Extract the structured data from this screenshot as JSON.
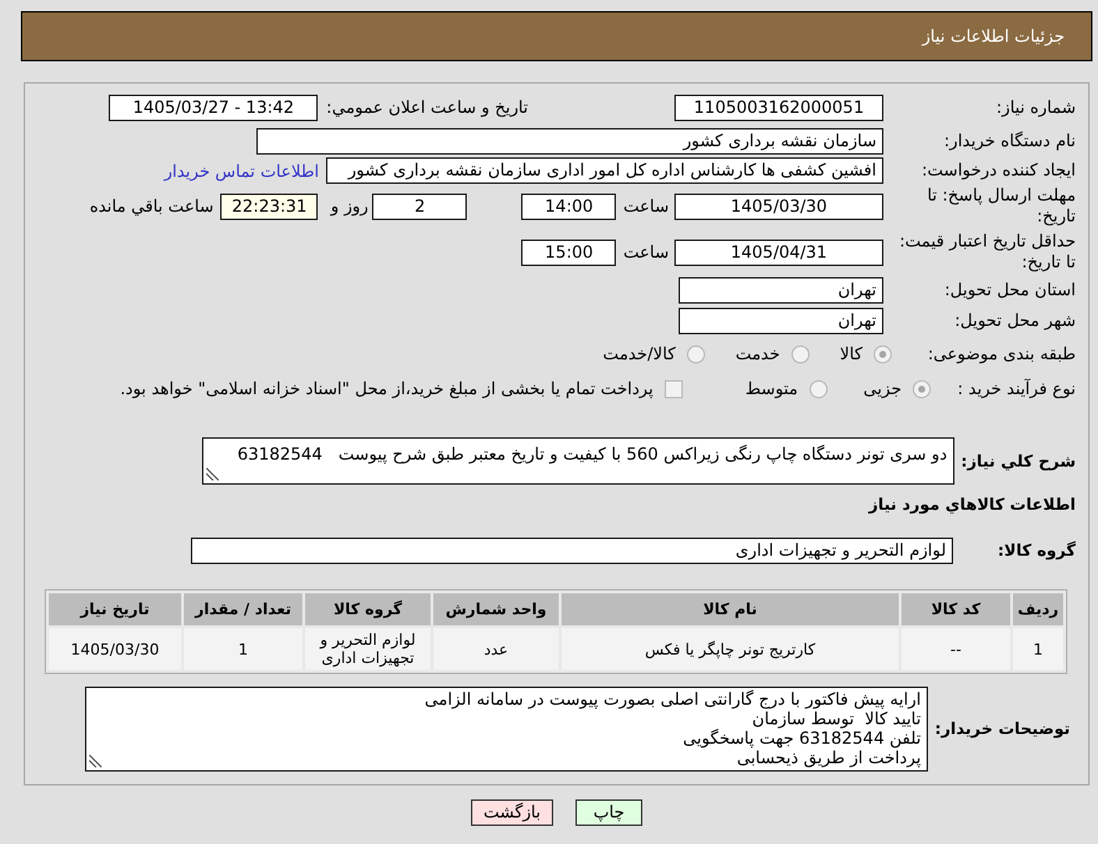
{
  "header": {
    "title": "جزئیات اطلاعات نیاز"
  },
  "need_number": {
    "label": "شماره نیاز:",
    "value": "1105003162000051"
  },
  "announce_datetime": {
    "label": "تاریخ و ساعت اعلان عمومي:",
    "value": "1405/03/27 - 13:42"
  },
  "buyer_org": {
    "label": "نام دستگاه خریدار:",
    "value": "سازمان نقشه برداری کشور"
  },
  "requester": {
    "label": "ایجاد کننده درخواست:",
    "value": "افشین کشفی ها کارشناس اداره کل امور اداری سازمان نقشه برداری کشور",
    "link": "اطلاعات تماس خریدار"
  },
  "response_deadline": {
    "label": "مهلت ارسال پاسخ: تا تاریخ:",
    "date": "1405/03/30",
    "time_label": "ساعت",
    "time": "14:00",
    "days": "2",
    "days_label": "روز و",
    "remaining": "22:23:31",
    "remaining_label": "ساعت باقي مانده"
  },
  "price_validity": {
    "label": "حداقل تاریخ اعتبار قیمت: تا تاریخ:",
    "date": "1405/04/31",
    "time_label": "ساعت",
    "time": "15:00"
  },
  "delivery_province": {
    "label": "استان محل تحویل:",
    "value": "تهران"
  },
  "delivery_city": {
    "label": "شهر محل تحویل:",
    "value": "تهران"
  },
  "subject_category": {
    "label": "طبقه بندی موضوعی:",
    "options": [
      {
        "label": "کالا",
        "selected": true,
        "disabled": true
      },
      {
        "label": "خدمت",
        "selected": false,
        "disabled": true
      },
      {
        "label": "کالا/خدمت",
        "selected": false,
        "disabled": true
      }
    ]
  },
  "purchase_process": {
    "label": "نوع فرآیند خرید :",
    "options": [
      {
        "label": "جزیی",
        "selected": true,
        "disabled": true
      },
      {
        "label": "متوسط",
        "selected": false,
        "disabled": true
      }
    ],
    "treasury_option": {
      "label": "پرداخت تمام یا بخشی از مبلغ خرید،از محل \"اسناد خزانه اسلامی\" خواهد بود.",
      "checked": false,
      "disabled": true
    }
  },
  "general_description": {
    "label": "شرح کلي نیاز:",
    "value": "دو سری تونر دستگاه چاپ رنگی زیراکس 560 با کیفیت و تاریخ معتبر طبق شرح پیوست   63182544"
  },
  "goods_heading": "اطلاعات کالاهاي مورد نیاز",
  "goods_group": {
    "label": "گروه کالا:",
    "value": "لوازم التحریر و تجهیزات اداری"
  },
  "goods_table": {
    "columns": [
      "ردیف",
      "کد کالا",
      "نام کالا",
      "واحد شمارش",
      "گروه کالا",
      "تعداد / مقدار",
      "تاریخ نیاز"
    ],
    "rows": [
      {
        "cells": [
          "1",
          "--",
          "کارتریج تونر چاپگر یا فکس",
          "عدد",
          "لوازم التحریر و تجهیزات اداری",
          "1",
          "1405/03/30"
        ]
      }
    ]
  },
  "buyer_notes": {
    "label": "توضیحات خریدار:",
    "value": "ارایه پیش فاکتور با درج گارانتی اصلی بصورت پیوست در سامانه الزامی\nتایید کالا  توسط سازمان\nتلفن 63182544 جهت پاسخگویی\nپرداخت از طریق ذیحسابی"
  },
  "buttons": [
    {
      "label": "چاپ",
      "kind": "print"
    },
    {
      "label": "بازگشت",
      "kind": "back"
    }
  ]
}
